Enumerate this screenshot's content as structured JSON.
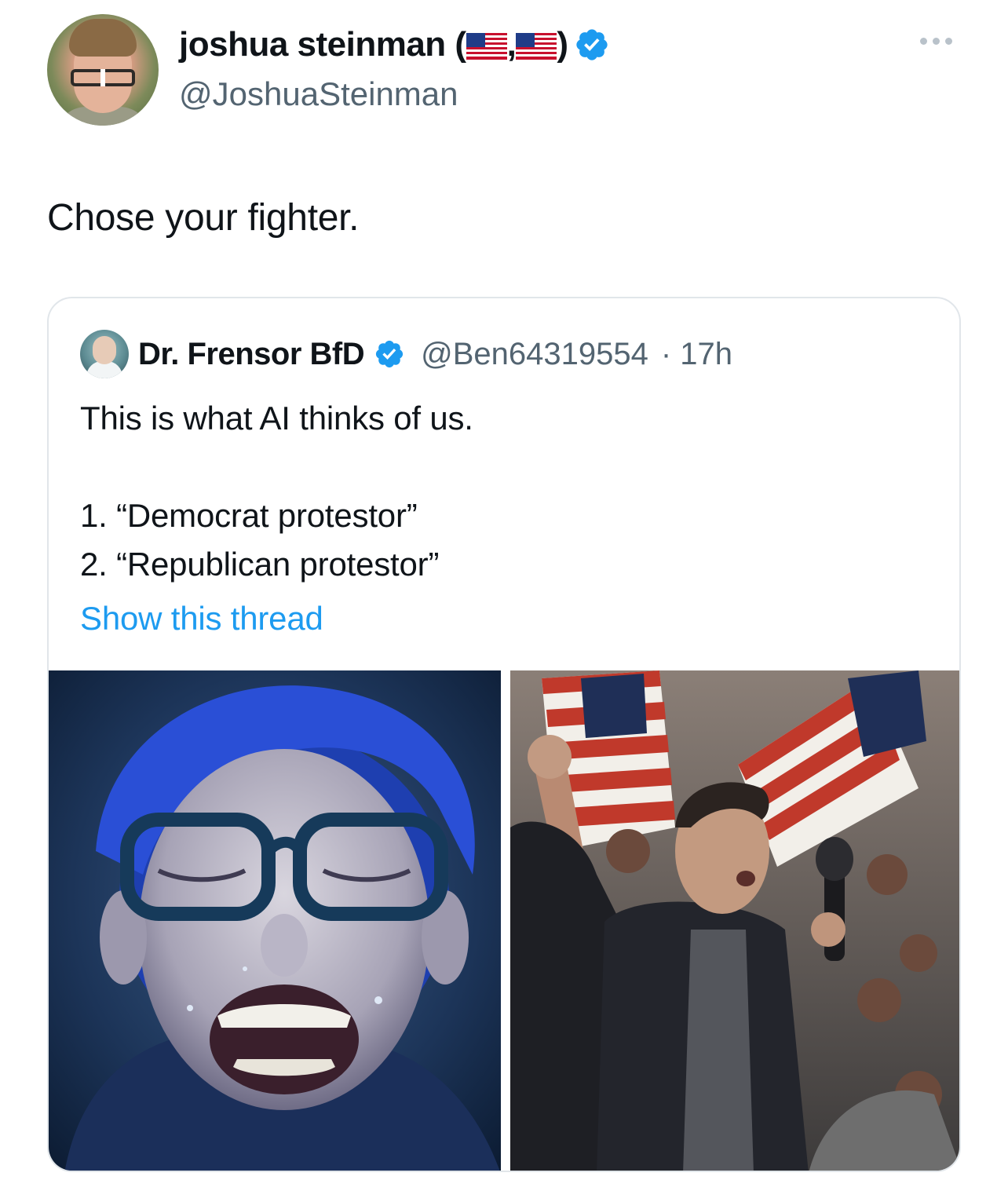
{
  "author": {
    "display_name": "joshua steinman (",
    "separator": ",",
    "closing": ")",
    "handle": "@JoshuaSteinman",
    "verified_icon": "verified-badge-icon",
    "name_emojis": [
      "us-flag-icon",
      "us-flag-icon"
    ]
  },
  "more_icon": "more-options-icon",
  "tweet_text": "Chose your fighter.",
  "quoted": {
    "display_name": "Dr. Frensor BfD",
    "handle": "@Ben64319554",
    "time": "· 17h",
    "text": "This is what AI thinks of us.\n\n1. “Democrat protestor”\n2. “Republican protestor”",
    "show_thread": "Show this thread",
    "media": [
      {
        "name": "image-left",
        "description_icon": "crying-blue-hair-woman-image"
      },
      {
        "name": "image-right",
        "description_icon": "man-raised-fist-crowd-flags-image"
      }
    ]
  },
  "colors": {
    "verified": "#1d9bf0",
    "link": "#1d9bf0",
    "secondary_text": "#536471",
    "border": "#e1e6ea"
  }
}
